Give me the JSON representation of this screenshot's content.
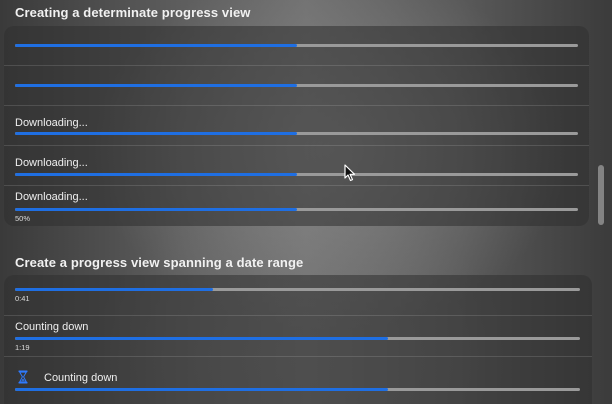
{
  "section1": {
    "title": "Creating a determinate progress view",
    "rows": [
      {
        "label": "",
        "progress": 0.5,
        "caption": ""
      },
      {
        "label": "",
        "progress": 0.5,
        "caption": ""
      },
      {
        "label": "Downloading...",
        "progress": 0.5,
        "caption": ""
      },
      {
        "label": "Downloading...",
        "progress": 0.5,
        "caption": ""
      },
      {
        "label": "Downloading...",
        "progress": 0.5,
        "caption": "50%"
      }
    ]
  },
  "section2": {
    "title": "Create a progress view spanning a date range",
    "rows": [
      {
        "label": "",
        "progress": 0.35,
        "caption": "0:41"
      },
      {
        "label": "Counting down",
        "progress": 0.66,
        "caption": "1:19"
      },
      {
        "label": "Counting down",
        "progress": 0.66,
        "caption": "",
        "icon": "hourglass-icon"
      }
    ]
  },
  "colors": {
    "accent": "#1f6fe3",
    "track": "#9a9a9a"
  }
}
